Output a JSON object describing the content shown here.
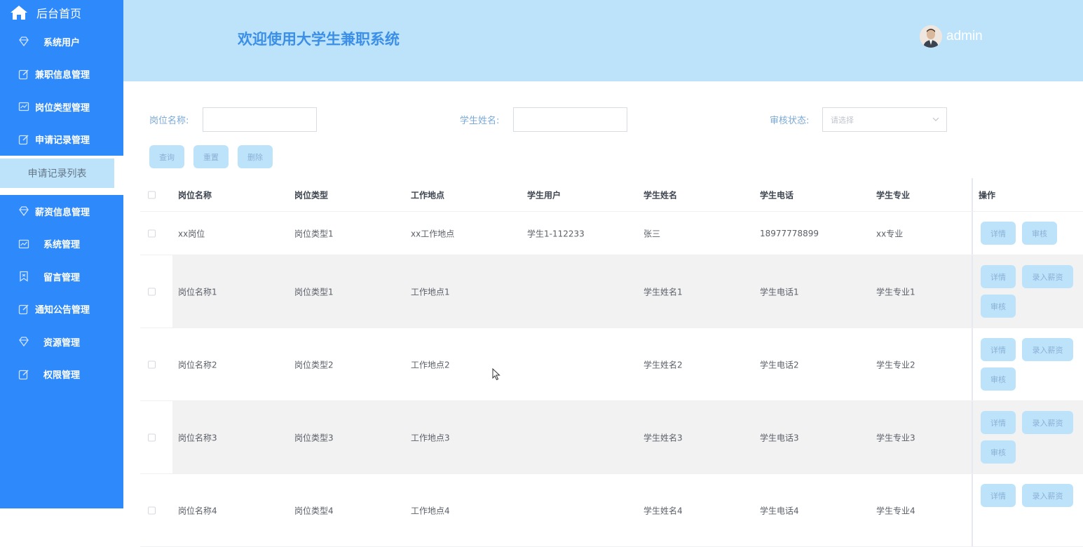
{
  "sidebar": {
    "home_label": "后台首页",
    "items": [
      {
        "label": "系统用户",
        "icon": "diamond-icon"
      },
      {
        "label": "兼职信息管理",
        "icon": "edit-icon"
      },
      {
        "label": "岗位类型管理",
        "icon": "chart-icon"
      },
      {
        "label": "申请记录管理",
        "icon": "edit-icon"
      }
    ],
    "sub_item": "申请记录列表",
    "items2": [
      {
        "label": "薪资信息管理",
        "icon": "diamond-icon"
      },
      {
        "label": "系统管理",
        "icon": "chart-icon"
      },
      {
        "label": "留言管理",
        "icon": "bookmark-icon"
      },
      {
        "label": "通知公告管理",
        "icon": "edit-icon"
      },
      {
        "label": "资源管理",
        "icon": "diamond-icon"
      },
      {
        "label": "权限管理",
        "icon": "edit-icon"
      }
    ]
  },
  "header": {
    "title": "欢迎使用大学生兼职系统",
    "username": "admin"
  },
  "search": {
    "position_label": "岗位名称:",
    "student_label": "学生姓名:",
    "status_label": "审核状态:",
    "status_placeholder": "请选择",
    "query_button": "查询",
    "reset_button": "重置",
    "delete_button": "删除"
  },
  "table": {
    "columns": [
      "岗位名称",
      "岗位类型",
      "工作地点",
      "学生用户",
      "学生姓名",
      "学生电话",
      "学生专业",
      "操作"
    ],
    "rows": [
      {
        "name": "xx岗位",
        "type": "岗位类型1",
        "location": "xx工作地点",
        "user": "学生1-112233",
        "student": "张三",
        "phone": "18977778899",
        "major": "xx专业"
      },
      {
        "name": "岗位名称1",
        "type": "岗位类型1",
        "location": "工作地点1",
        "user": "",
        "student": "学生姓名1",
        "phone": "学生电话1",
        "major": "学生专业1"
      },
      {
        "name": "岗位名称2",
        "type": "岗位类型2",
        "location": "工作地点2",
        "user": "",
        "student": "学生姓名2",
        "phone": "学生电话2",
        "major": "学生专业2"
      },
      {
        "name": "岗位名称3",
        "type": "岗位类型3",
        "location": "工作地点3",
        "user": "",
        "student": "学生姓名3",
        "phone": "学生电话3",
        "major": "学生专业3"
      },
      {
        "name": "岗位名称4",
        "type": "岗位类型4",
        "location": "工作地点4",
        "user": "",
        "student": "学生姓名4",
        "phone": "学生电话4",
        "major": "学生专业4"
      }
    ],
    "detail_button": "详情",
    "salary_button": "录入薪资",
    "audit_button": "审核"
  },
  "colors": {
    "sidebar_bg": "#2e89fb",
    "header_bg": "#bde3fb",
    "accent": "#3b8fe6"
  }
}
